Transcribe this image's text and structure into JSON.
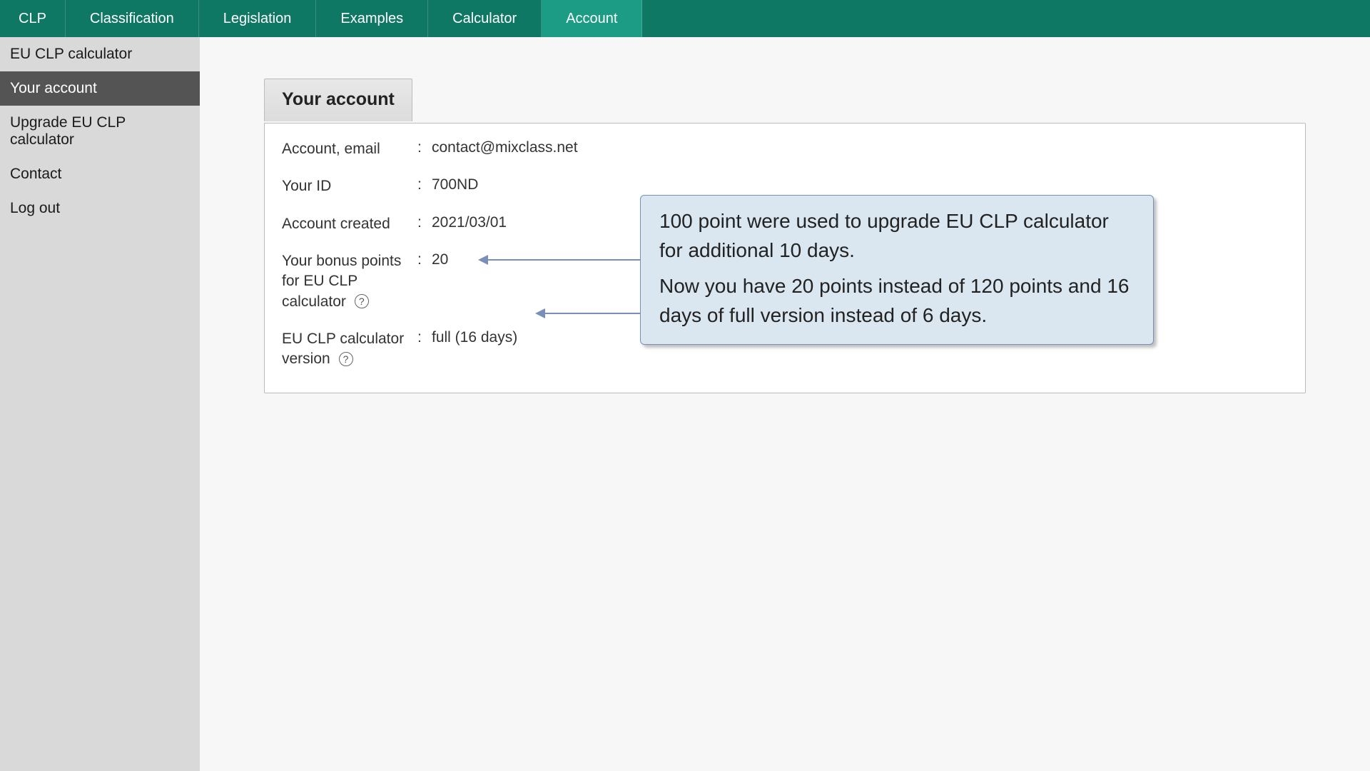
{
  "topnav": {
    "items": [
      {
        "label": "CLP"
      },
      {
        "label": "Classification"
      },
      {
        "label": "Legislation"
      },
      {
        "label": "Examples"
      },
      {
        "label": "Calculator"
      },
      {
        "label": "Account"
      }
    ]
  },
  "sidebar": {
    "items": [
      {
        "label": "EU CLP calculator"
      },
      {
        "label": "Your account"
      },
      {
        "label": "Upgrade EU CLP calculator"
      },
      {
        "label": "Contact"
      },
      {
        "label": "Log out"
      }
    ]
  },
  "panel": {
    "title": "Your account",
    "rows": {
      "email_label": "Account, email",
      "email_value": "contact@mixclass.net",
      "id_label": "Your ID",
      "id_value": "700ND",
      "created_label": "Account created",
      "created_value": "2021/03/01",
      "bonus_label": "Your bonus points for EU CLP calculator",
      "bonus_value": "20",
      "version_label": "EU CLP calculator version",
      "version_value": "full (16 days)"
    },
    "help_glyph": "?"
  },
  "callout": {
    "p1": "100 point were used to upgrade EU CLP calculator for additional 10 days.",
    "p2": "Now you have 20 points instead of 120 points and 16 days of full version instead of 6 days."
  },
  "colon": ":"
}
